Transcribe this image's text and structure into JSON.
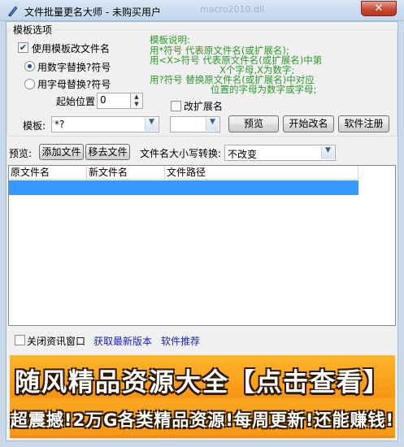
{
  "window": {
    "title": "文件批量更名大师 - 未购买用户",
    "ghost_title": "macro2010.dll",
    "close_label": "✕"
  },
  "template_group": {
    "title": "模板选项",
    "use_template_label": "使用模板改文件名",
    "use_template_checked": true,
    "radio_number_label": "用数字替换?符号",
    "radio_letter_label": "用字母替换?符号",
    "radio_selected": "number",
    "start_label": "起始位置",
    "start_value": "0",
    "change_ext_label": "改扩展名",
    "change_ext_checked": false,
    "template_label": "模板:",
    "template_value": "*?",
    "ext_value": "",
    "preview_button": "预览",
    "start_rename_button": "开始改名",
    "register_button": "软件注册",
    "help": {
      "line1": "模板说明:",
      "line2": "用*符号 代表原文件名(或扩展名);",
      "line3": "用<X>符号 代表原文件名(或扩展名)中第",
      "line4": "X个字母,X为数字;",
      "line5": "用?符号 替换原文件名(或扩展名)中对应",
      "line6": "位置的字母为数字或字母;"
    }
  },
  "toolbar": {
    "preview_label": "预览:",
    "add_file_button": "添加文件",
    "remove_file_button": "移去文件",
    "case_label": "文件名大小写转换:",
    "case_value": "不改变"
  },
  "file_list": {
    "columns": [
      "原文件名",
      "新文件名",
      "文件路径"
    ],
    "rows": []
  },
  "footer": {
    "close_news_label": "关闭资讯窗口",
    "close_news_checked": false,
    "latest_version_link": "获取最新版本",
    "recommend_link": "软件推荐"
  },
  "banner": {
    "line1": "随风精品资源大全【点击查看】",
    "line2": "超震撼!2万G各类精品资源!每周更新!还能赚钱!"
  }
}
